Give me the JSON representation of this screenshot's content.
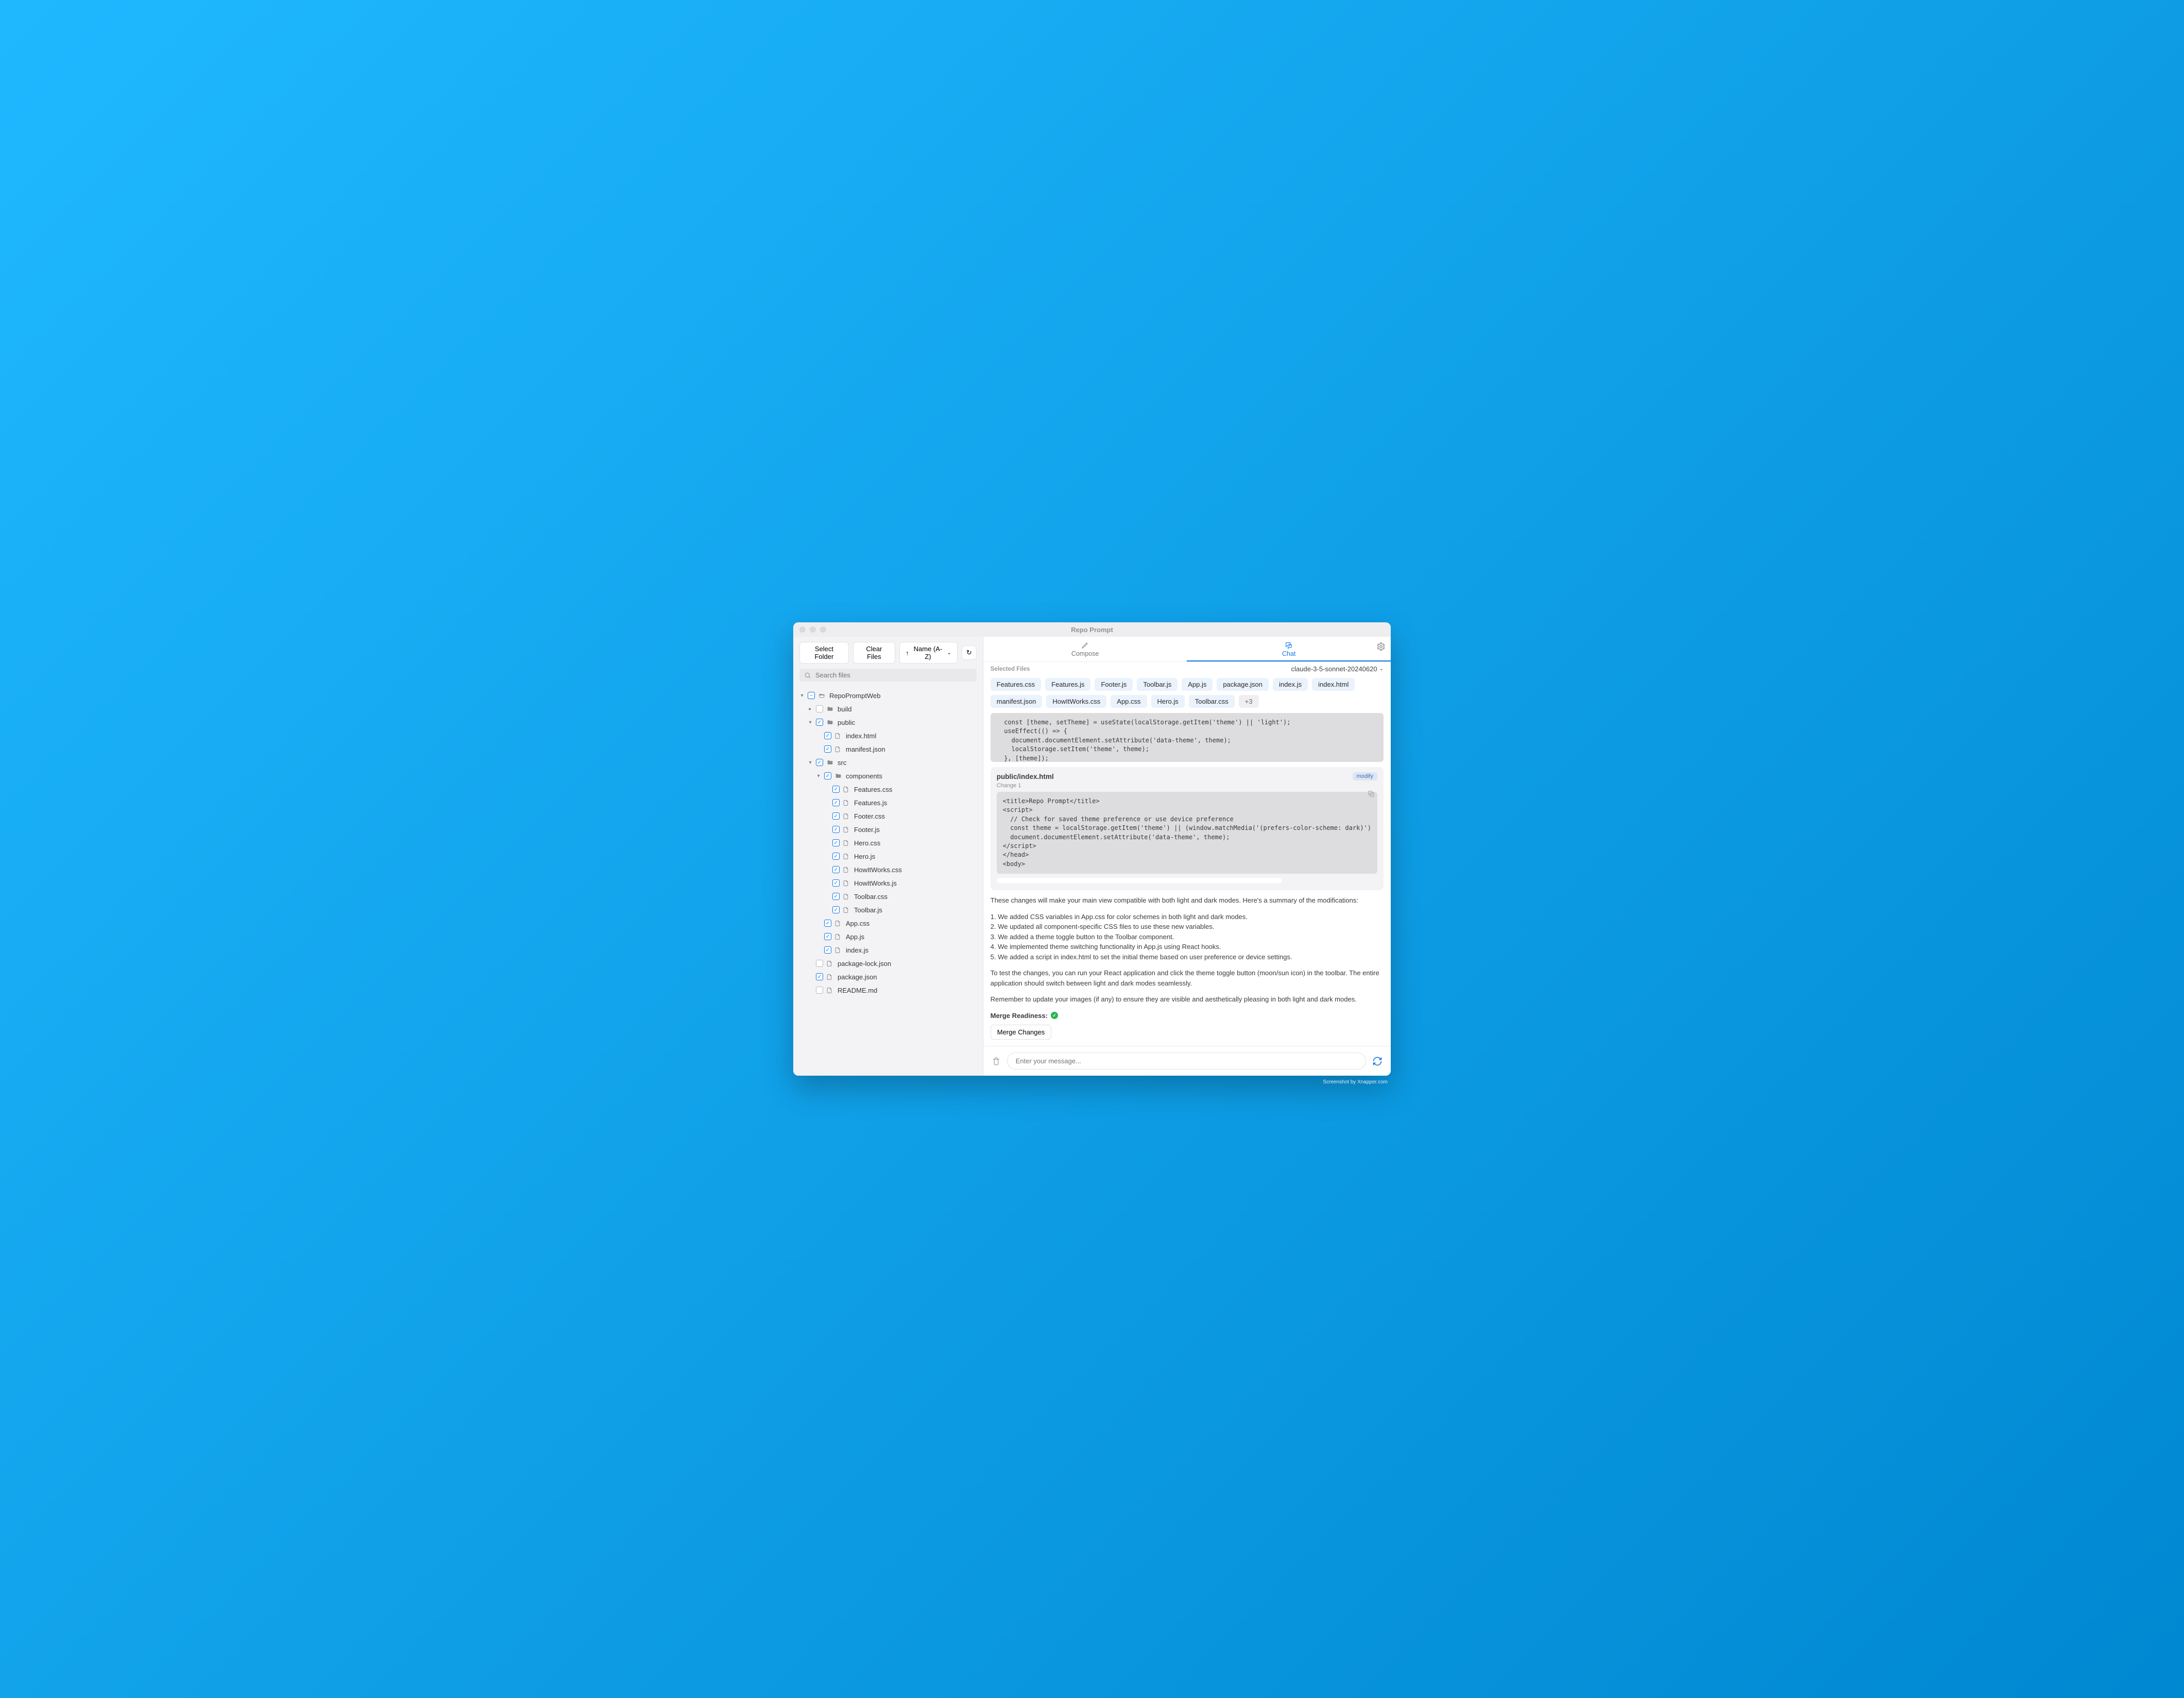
{
  "window": {
    "title": "Repo Prompt"
  },
  "toolbar": {
    "select_folder": "Select Folder",
    "clear_files": "Clear Files",
    "sort_label": "Name (A-Z)"
  },
  "search": {
    "placeholder": "Search files"
  },
  "tree": [
    {
      "d": 0,
      "chev": "down",
      "check": "ind",
      "kind": "folder-open",
      "name": "RepoPromptWeb"
    },
    {
      "d": 1,
      "chev": "right",
      "check": "off",
      "kind": "folder",
      "name": "build"
    },
    {
      "d": 1,
      "chev": "down",
      "check": "on",
      "kind": "folder",
      "name": "public"
    },
    {
      "d": 2,
      "chev": "",
      "check": "on",
      "kind": "file",
      "name": "index.html"
    },
    {
      "d": 2,
      "chev": "",
      "check": "on",
      "kind": "file",
      "name": "manifest.json"
    },
    {
      "d": 1,
      "chev": "down",
      "check": "on",
      "kind": "folder",
      "name": "src"
    },
    {
      "d": 2,
      "chev": "down",
      "check": "on",
      "kind": "folder",
      "name": "components"
    },
    {
      "d": 3,
      "chev": "",
      "check": "on",
      "kind": "file",
      "name": "Features.css"
    },
    {
      "d": 3,
      "chev": "",
      "check": "on",
      "kind": "file",
      "name": "Features.js"
    },
    {
      "d": 3,
      "chev": "",
      "check": "on",
      "kind": "file",
      "name": "Footer.css"
    },
    {
      "d": 3,
      "chev": "",
      "check": "on",
      "kind": "file",
      "name": "Footer.js"
    },
    {
      "d": 3,
      "chev": "",
      "check": "on",
      "kind": "file",
      "name": "Hero.css"
    },
    {
      "d": 3,
      "chev": "",
      "check": "on",
      "kind": "file",
      "name": "Hero.js"
    },
    {
      "d": 3,
      "chev": "",
      "check": "on",
      "kind": "file",
      "name": "HowItWorks.css"
    },
    {
      "d": 3,
      "chev": "",
      "check": "on",
      "kind": "file",
      "name": "HowItWorks.js"
    },
    {
      "d": 3,
      "chev": "",
      "check": "on",
      "kind": "file",
      "name": "Toolbar.css"
    },
    {
      "d": 3,
      "chev": "",
      "check": "on",
      "kind": "file",
      "name": "Toolbar.js"
    },
    {
      "d": 2,
      "chev": "",
      "check": "on",
      "kind": "file",
      "name": "App.css"
    },
    {
      "d": 2,
      "chev": "",
      "check": "on",
      "kind": "file",
      "name": "App.js"
    },
    {
      "d": 2,
      "chev": "",
      "check": "on",
      "kind": "file",
      "name": "index.js"
    },
    {
      "d": 1,
      "chev": "",
      "check": "off",
      "kind": "file",
      "name": "package-lock.json"
    },
    {
      "d": 1,
      "chev": "",
      "check": "on",
      "kind": "file",
      "name": "package.json"
    },
    {
      "d": 1,
      "chev": "",
      "check": "off",
      "kind": "file",
      "name": "README.md"
    }
  ],
  "tabs": {
    "compose": "Compose",
    "chat": "Chat"
  },
  "header": {
    "selected_files_label": "Selected Files",
    "model": "claude-3-5-sonnet-20240620"
  },
  "chips": {
    "row1": [
      "Features.css",
      "Features.js",
      "Footer.js",
      "Toolbar.js",
      "App.js",
      "package.json",
      "index.js"
    ],
    "row2": [
      "index.html",
      "manifest.json",
      "HowItWorks.css",
      "App.css",
      "Hero.js",
      "Toolbar.css"
    ],
    "more": "+3"
  },
  "code1": "  const [theme, setTheme] = useState(localStorage.getItem('theme') || 'light');\n  useEffect(() => {\n    document.documentElement.setAttribute('data-theme', theme);\n    localStorage.setItem('theme', theme);\n  }, [theme]);\n  const toggleTheme = () => {\n    setTheme(theme === 'light' ? 'dark' : 'light');\n  };\n  return (\n    <div className=\"App\">\n      <Toolbar toggleTheme={toggleTheme} />\n      <Hero />\n      <Features />\n      <HowItWorks />\n      <Footer />\n    </div>\n  );\n}\nexport default App;",
  "card2": {
    "path": "public/index.html",
    "badge": "modify",
    "change": "Change 1",
    "code": "<title>Repo Prompt</title>\n<script>\n  // Check for saved theme preference or use device preference\n  const theme = localStorage.getItem('theme') || (window.matchMedia('(prefers-color-scheme: dark)')\n  document.documentElement.setAttribute('data-theme', theme);\n</script>\n</head>\n<body>"
  },
  "summary": {
    "intro": "These changes will make your main view compatible with both light and dark modes. Here's a summary of the modifications:",
    "l1": "1. We added CSS variables in App.css for color schemes in both light and dark modes.",
    "l2": "2. We updated all component-specific CSS files to use these new variables.",
    "l3": "3. We added a theme toggle button to the Toolbar component.",
    "l4": "4. We implemented theme switching functionality in App.js using React hooks.",
    "l5": "5. We added a script in index.html to set the initial theme based on user preference or device settings.",
    "test": "To test the changes, you can run your React application and click the theme toggle button (moon/sun icon) in the toolbar. The entire application should switch between light and dark modes seamlessly.",
    "note": "Remember to update your images (if any) to ensure they are visible and aesthetically pleasing in both light and dark modes.",
    "merge_label": "Merge Readiness:",
    "merge_button": "Merge Changes"
  },
  "input": {
    "placeholder": "Enter your message..."
  },
  "watermark": "Screenshot by Xnapper.com"
}
